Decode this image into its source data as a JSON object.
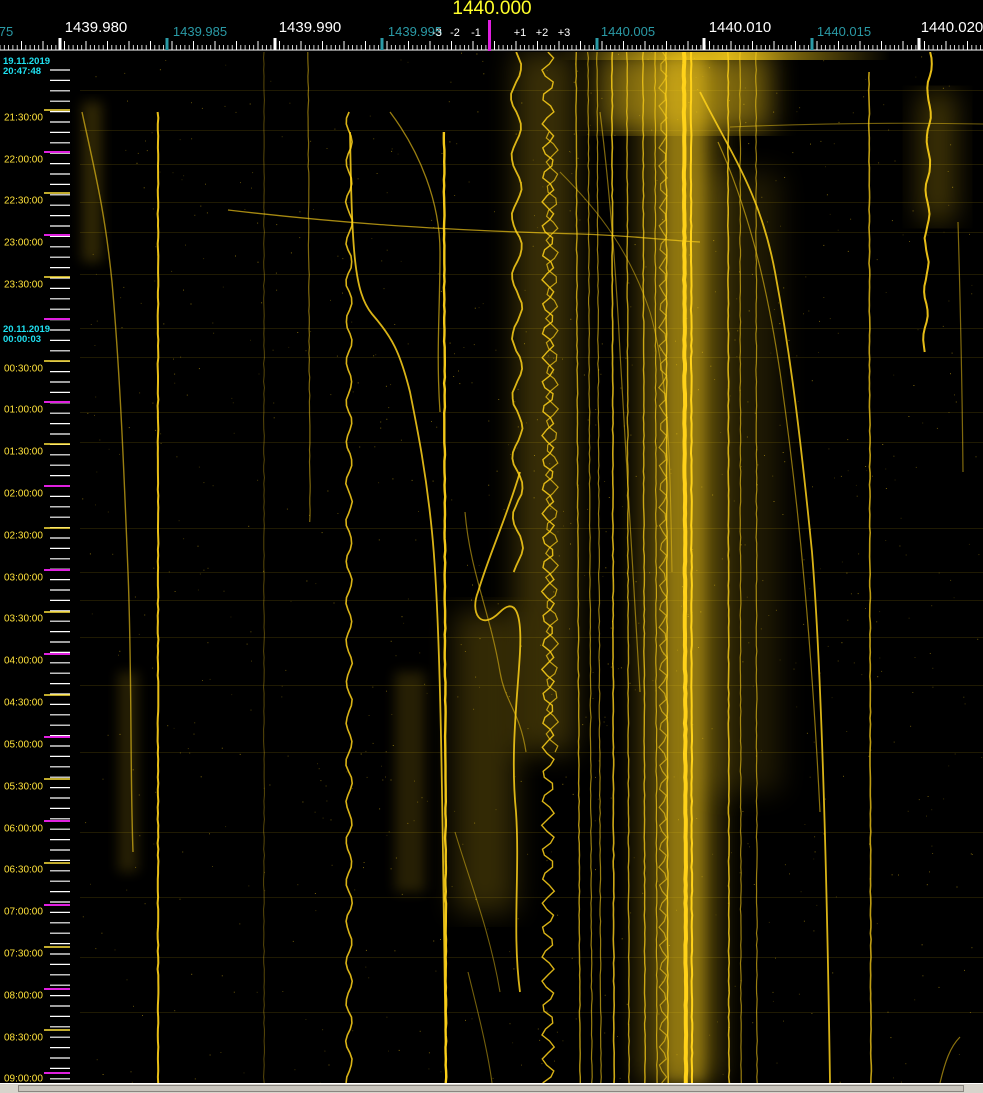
{
  "center_frequency": "1440.000",
  "freq_axis": {
    "major": [
      "1439.980",
      "1439.990",
      "1440.010",
      "1440.020"
    ],
    "minor": [
      "1439.985",
      "1439.995",
      "1440.005",
      "1440.015"
    ],
    "edge_left": "75",
    "offsets": [
      "-3",
      "-2",
      "-1",
      "+1",
      "+2",
      "+3"
    ]
  },
  "time_axis": {
    "start_date": "19.11.2019",
    "start_time": "20:47:48",
    "midnight_date": "20.11.2019",
    "midnight_time": "00:00:03",
    "labels": [
      "21:30:00",
      "22:00:00",
      "22:30:00",
      "23:00:00",
      "23:30:00",
      "00:30:00",
      "01:00:00",
      "01:30:00",
      "02:00:00",
      "02:30:00",
      "03:00:00",
      "03:30:00",
      "04:00:00",
      "04:30:00",
      "05:00:00",
      "05:30:00",
      "06:00:00",
      "06:30:00",
      "07:00:00",
      "07:30:00",
      "08:00:00",
      "08:30:00",
      "09:00:00"
    ]
  },
  "colors": {
    "trace": "#ffd21a",
    "major_label": "#ffffff",
    "minor_label": "#2a9aa6",
    "center_marker": "#e020e0",
    "date_label": "#1fe0f0",
    "time_label": "#ffe23a"
  }
}
